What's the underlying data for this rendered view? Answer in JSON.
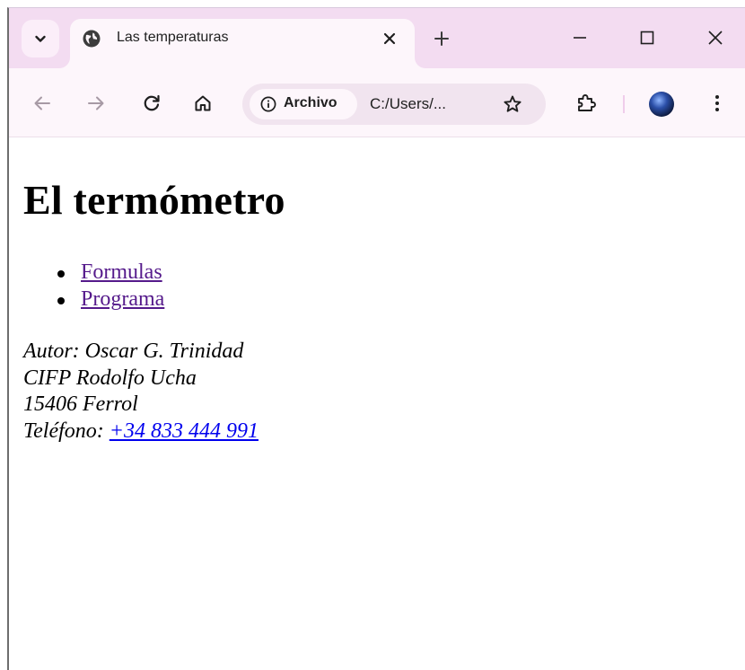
{
  "browser": {
    "tab": {
      "title": "Las temperaturas",
      "favicon": "globe-icon"
    },
    "address_bar": {
      "chip_label": "Archivo",
      "url": "C:/Users/..."
    },
    "accent_colors": {
      "tabstrip": "#f3dcf1",
      "toolbar": "#fdf6fb",
      "omnibox": "#f1e4ef"
    }
  },
  "page": {
    "heading": "El termómetro",
    "nav_links": [
      {
        "label": "Formulas"
      },
      {
        "label": "Programa"
      }
    ],
    "address": {
      "author": "Autor: Oscar G. Trinidad",
      "school": "CIFP Rodolfo Ucha",
      "city": "15406 Ferrol",
      "phone_label": "Teléfono: ",
      "phone": "+34 833 444 991"
    }
  }
}
